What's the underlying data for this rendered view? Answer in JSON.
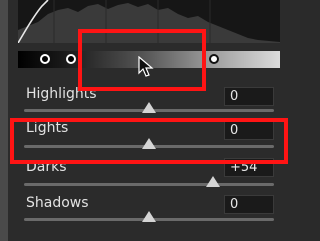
{
  "split_toning": {
    "gradient_handles": [
      "split-handle-shadows",
      "split-handle-midtones",
      "split-handle-highlights"
    ]
  },
  "sliders": [
    {
      "label": "Highlights",
      "value": "0"
    },
    {
      "label": "Lights",
      "value": "0"
    },
    {
      "label": "Darks",
      "value": "+54"
    },
    {
      "label": "Shadows",
      "value": "0"
    }
  ],
  "annotation_color": "#ff1414",
  "icons": {
    "cursor": "arrow-pointer-icon"
  }
}
